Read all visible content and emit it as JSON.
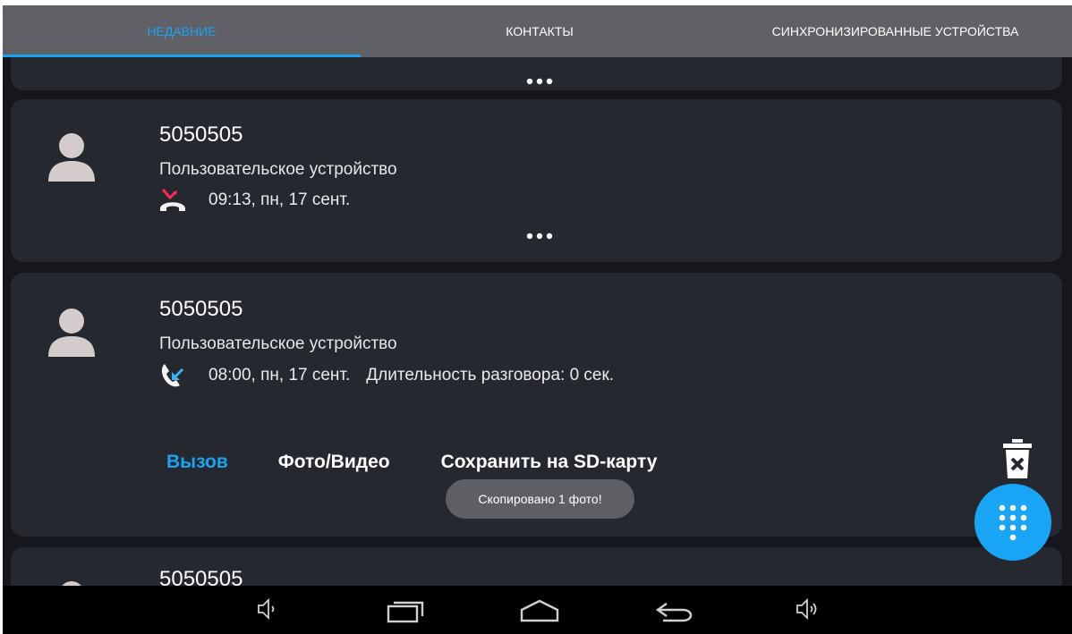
{
  "tabs": [
    {
      "label": "Недавние",
      "active": true
    },
    {
      "label": "Контакты",
      "active": false
    },
    {
      "label": "Синхронизированные устройства",
      "active": false
    }
  ],
  "calls": [
    {
      "number": "5050505",
      "device": "Пользовательское устройство",
      "time": "09:13, пн, 17 сент.",
      "type": "missed",
      "icon": "missed-call-icon"
    },
    {
      "number": "5050505",
      "device": "Пользовательское устройство",
      "time": "08:00, пн, 17 сент.",
      "duration": "Длительность разговора: 0 сек.",
      "type": "incoming",
      "icon": "incoming-call-icon"
    },
    {
      "number": "5050505"
    }
  ],
  "actions": {
    "call": "Вызов",
    "media": "Фото/Видео",
    "save_sd": "Сохранить на SD-карту"
  },
  "toast": "Скопировано 1 фото!",
  "colors": {
    "accent": "#1aa3f3",
    "missed": "#ff2a55",
    "card": "#25282e",
    "tabbar": "#5f6166"
  },
  "icons": {
    "avatar": "person-icon",
    "more": "more-dots-icon",
    "delete": "trash-icon",
    "fab": "dialpad-icon",
    "collapse": "chevron-up-icon",
    "nav": [
      "volume-down-icon",
      "recent-apps-icon",
      "home-icon",
      "back-icon",
      "volume-up-icon"
    ]
  }
}
